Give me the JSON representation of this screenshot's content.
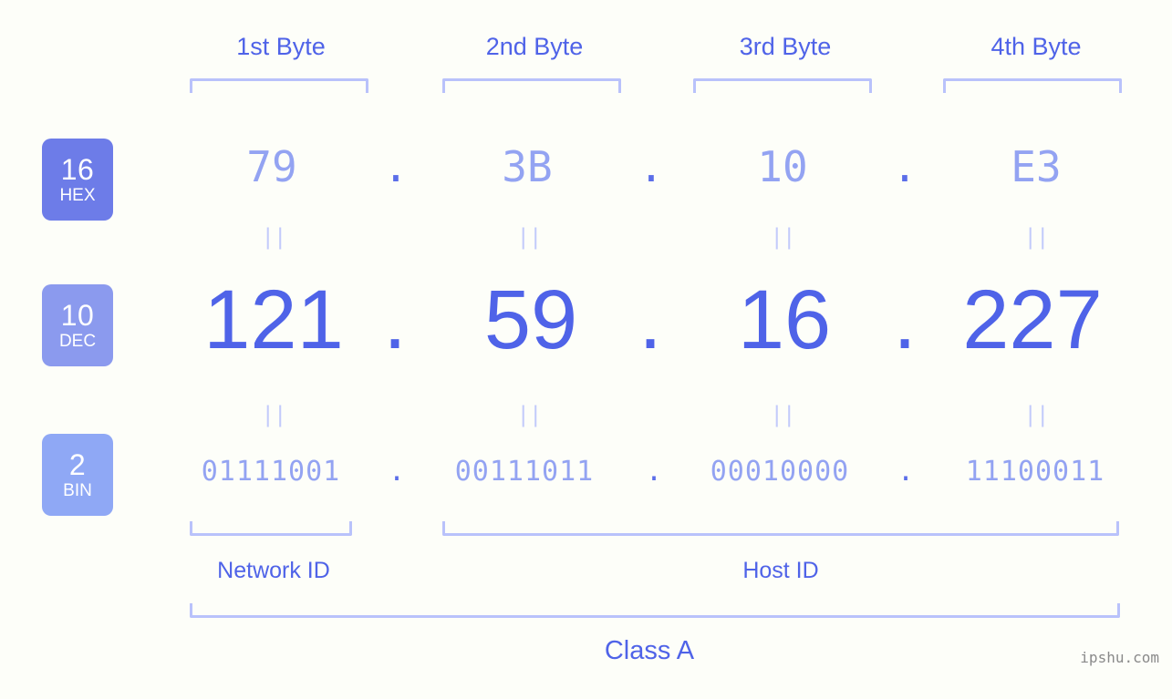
{
  "header": {
    "byte_labels": [
      "1st Byte",
      "2nd Byte",
      "3rd Byte",
      "4th Byte"
    ]
  },
  "bases": [
    {
      "number": "16",
      "name": "HEX",
      "color": "#6d7ce8"
    },
    {
      "number": "10",
      "name": "DEC",
      "color": "#8b9aee"
    },
    {
      "number": "2",
      "name": "BIN",
      "color": "#8fa8f5"
    }
  ],
  "rows": {
    "hex": {
      "values": [
        "79",
        "3B",
        "10",
        "E3"
      ],
      "separator": "."
    },
    "dec": {
      "values": [
        "121",
        "59",
        "16",
        "227"
      ],
      "separator": "."
    },
    "bin": {
      "values": [
        "01111001",
        "00111011",
        "00010000",
        "11100011"
      ],
      "separator": "."
    }
  },
  "equals_marker": "||",
  "footer": {
    "network_id_label": "Network ID",
    "host_id_label": "Host ID",
    "class_label": "Class A"
  },
  "watermark": "ipshu.com",
  "colors": {
    "background": "#fdfef9",
    "accent_strong": "#4f63e8",
    "accent_light": "#93a3f2",
    "bracket": "#b9c2fb",
    "equals": "#c3cbfb",
    "watermark": "#8a8a8a"
  },
  "ip_address": "121.59.16.227"
}
